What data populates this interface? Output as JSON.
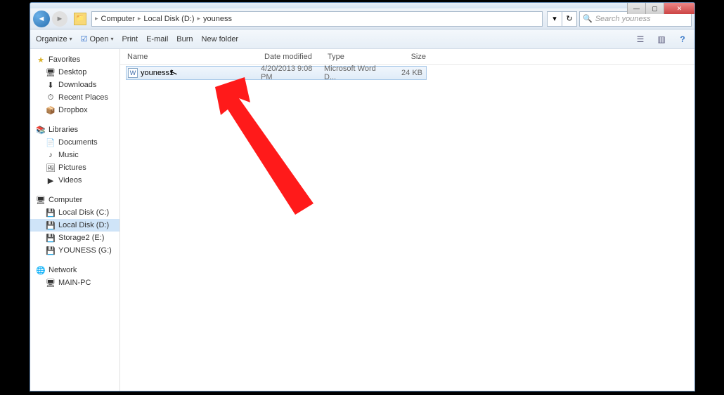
{
  "window": {
    "min": "—",
    "max": "▢",
    "close": "✕"
  },
  "nav": {
    "back": "◄",
    "fwd": "►",
    "breadcrumb": {
      "seg1": "Computer",
      "seg2": "Local Disk (D:)",
      "seg3": "youness",
      "arr": "▸"
    },
    "refresh": "↻",
    "down": "▾",
    "search": {
      "placeholder": "Search youness",
      "icon": "🔍"
    }
  },
  "toolbar": {
    "organize": "Organize",
    "open": "Open",
    "print": "Print",
    "email": "E-mail",
    "burn": "Burn",
    "newfolder": "New folder",
    "arr": "▾",
    "views": "☰",
    "preview": "▥",
    "help": "?"
  },
  "sidebar": {
    "favorites": {
      "label": "Favorites",
      "icon": "★",
      "items": [
        {
          "icon": "🖥",
          "label": "Desktop"
        },
        {
          "icon": "⬇",
          "label": "Downloads"
        },
        {
          "icon": "⏱",
          "label": "Recent Places"
        },
        {
          "icon": "📦",
          "label": "Dropbox"
        }
      ]
    },
    "libraries": {
      "label": "Libraries",
      "icon": "📚",
      "items": [
        {
          "icon": "📄",
          "label": "Documents"
        },
        {
          "icon": "♪",
          "label": "Music"
        },
        {
          "icon": "🖼",
          "label": "Pictures"
        },
        {
          "icon": "▶",
          "label": "Videos"
        }
      ]
    },
    "computer": {
      "label": "Computer",
      "icon": "🖥",
      "items": [
        {
          "icon": "💾",
          "label": "Local Disk (C:)"
        },
        {
          "icon": "💾",
          "label": "Local Disk (D:)",
          "sel": true
        },
        {
          "icon": "💾",
          "label": "Storage2 (E:)"
        },
        {
          "icon": "💾",
          "label": "YOUNESS (G:)"
        }
      ]
    },
    "network": {
      "label": "Network",
      "icon": "🌐",
      "items": [
        {
          "icon": "🖥",
          "label": "MAIN-PC"
        }
      ]
    }
  },
  "columns": {
    "name": "Name",
    "date": "Date modified",
    "type": "Type",
    "size": "Size"
  },
  "files": [
    {
      "icon": "W",
      "name": "youness1",
      "date": "4/20/2013 9:08 PM",
      "type": "Microsoft Word D...",
      "size": "24 KB"
    }
  ]
}
